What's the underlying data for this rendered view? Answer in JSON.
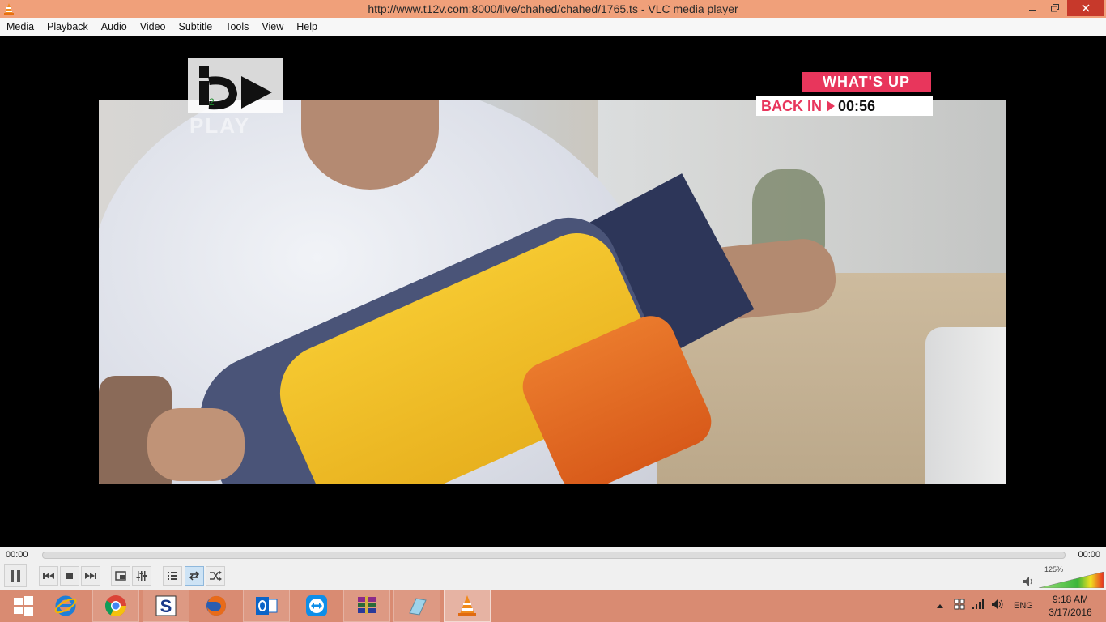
{
  "window": {
    "title": "http://www.t12v.com:8000/live/chahed/chahed/1765.ts - VLC media player"
  },
  "menu": [
    "Media",
    "Playback",
    "Audio",
    "Video",
    "Subtitle",
    "Tools",
    "View",
    "Help"
  ],
  "video_overlay": {
    "logo_sub": "PLAY",
    "logo_number": "2",
    "badge_title": "WHAT'S UP",
    "badge_back": "BACK IN",
    "badge_time": "00:56"
  },
  "playback": {
    "current_time": "00:00",
    "total_time": "00:00",
    "progress": 0
  },
  "controls": {
    "buttons": [
      "pause-icon",
      "previous-icon",
      "stop-icon",
      "next-icon",
      "fullscreen-icon",
      "extended-settings-icon",
      "playlist-icon",
      "loop-icon",
      "shuffle-icon"
    ],
    "active": [
      "loop-icon"
    ]
  },
  "volume": {
    "label": "125%",
    "level": 1.25
  },
  "taskbar": {
    "apps": [
      "windows-start-icon",
      "internet-explorer-icon",
      "chrome-icon",
      "app-s-icon",
      "firefox-icon",
      "outlook-icon",
      "teamviewer-icon",
      "winrar-icon",
      "notepad-icon",
      "vlc-icon"
    ],
    "active_app": "vlc-icon",
    "language": "ENG",
    "time": "9:18 AM",
    "date": "3/17/2016"
  },
  "colors": {
    "titlebar": "#f0a07a",
    "taskbar": "#d98b72",
    "close": "#c7392b",
    "badge": "#e8365c"
  }
}
